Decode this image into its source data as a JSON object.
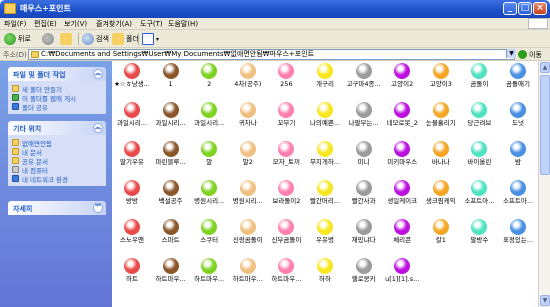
{
  "window": {
    "title": "매우스+포인트"
  },
  "menu": [
    "파일(F)",
    "편집(E)",
    "보기(V)",
    "즐겨찾기(A)",
    "도구(T)",
    "도움말(H)"
  ],
  "toolbar": {
    "back": "뒤로",
    "search": "검색",
    "folders": "폴더"
  },
  "address": {
    "label": "주소(D)",
    "path": "C:₩Documents and Settings₩User₩My Documents₩없애면안됨₩마우스+포인트",
    "go": "이동"
  },
  "tasks": {
    "file_folder": {
      "title": "파일 및 폴더 작업",
      "links": [
        "새 폴더 만들기",
        "이 폴더를 웹에 게시",
        "폴더 공유"
      ]
    },
    "other_places": {
      "title": "기타 위치",
      "links": [
        "없애면안됨",
        "내 문서",
        "공유 문서",
        "내 컴퓨터",
        "내 네트워크 환경"
      ]
    },
    "details": {
      "title": "자세히"
    }
  },
  "items": [
    "★☆ㅎ낭생...",
    "1",
    "2",
    "4차(공주)",
    "256",
    "개구리",
    "고구마4종...",
    "고양이2",
    "고양이3",
    "곰돌이",
    "곰돌애기",
    "과일시리...",
    "과일시리...",
    "과일시리...",
    "귀차나",
    "꼬부기",
    "나의예쁜...",
    "나팔부는...",
    "네모로봇_2",
    "눈물흘리기",
    "당근려브",
    "도넛",
    "딸기우유",
    "마린블루...",
    "말",
    "말2",
    "모자_토끼",
    "무지개하...",
    "미니",
    "미키마우스",
    "바나나",
    "바이올린",
    "밤",
    "방방",
    "백설공주",
    "병원시리...",
    "병원시리...",
    "보라돌이2",
    "빨간머리...",
    "빨간사과",
    "생일케이크",
    "생크림케익",
    "소프트아...",
    "소프트아...",
    "스노우맨",
    "스마트",
    "스쿠터",
    "신랑곰돌이",
    "신부곰돌이",
    "우유병",
    "재밌냐다",
    "체리콘",
    "칼1",
    "팔방수",
    "표정있는...",
    "하트",
    "하트마우...",
    "하트마우...",
    "하트마우...",
    "하트마우...",
    "하하",
    "헬로몽키",
    "u[1][1].s..."
  ]
}
